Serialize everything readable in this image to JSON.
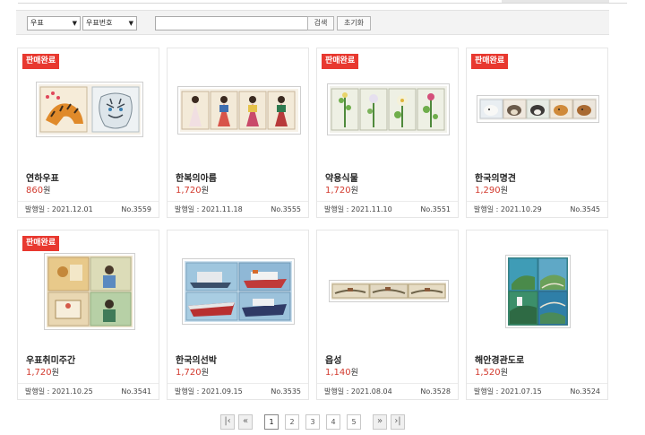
{
  "search": {
    "category_value": "우표",
    "field_value": "우표번호",
    "query_value": "",
    "search_label": "검색",
    "reset_label": "초기화"
  },
  "badge_label": "판매완료",
  "date_prefix": "발행일 : ",
  "currency": "원",
  "products": [
    {
      "name": "연하우표",
      "price": "860",
      "date": "2021.12.01",
      "no": "No.3559",
      "sold_out": true
    },
    {
      "name": "한복의아름",
      "price": "1,720",
      "date": "2021.11.18",
      "no": "No.3555",
      "sold_out": false
    },
    {
      "name": "약용식물",
      "price": "1,720",
      "date": "2021.11.10",
      "no": "No.3551",
      "sold_out": true
    },
    {
      "name": "한국의명견",
      "price": "1,290",
      "date": "2021.10.29",
      "no": "No.3545",
      "sold_out": true
    },
    {
      "name": "우표취미주간",
      "price": "1,720",
      "date": "2021.10.25",
      "no": "No.3541",
      "sold_out": true
    },
    {
      "name": "한국의선박",
      "price": "1,720",
      "date": "2021.09.15",
      "no": "No.3535",
      "sold_out": false
    },
    {
      "name": "읍성",
      "price": "1,140",
      "date": "2021.08.04",
      "no": "No.3528",
      "sold_out": false
    },
    {
      "name": "해안경관도로",
      "price": "1,520",
      "date": "2021.07.15",
      "no": "No.3524",
      "sold_out": false
    }
  ],
  "pagination": {
    "pages": [
      "1",
      "2",
      "3",
      "4",
      "5"
    ],
    "current": "1"
  },
  "colors": {
    "badge": "#e8382f",
    "price": "#d23a2e"
  }
}
